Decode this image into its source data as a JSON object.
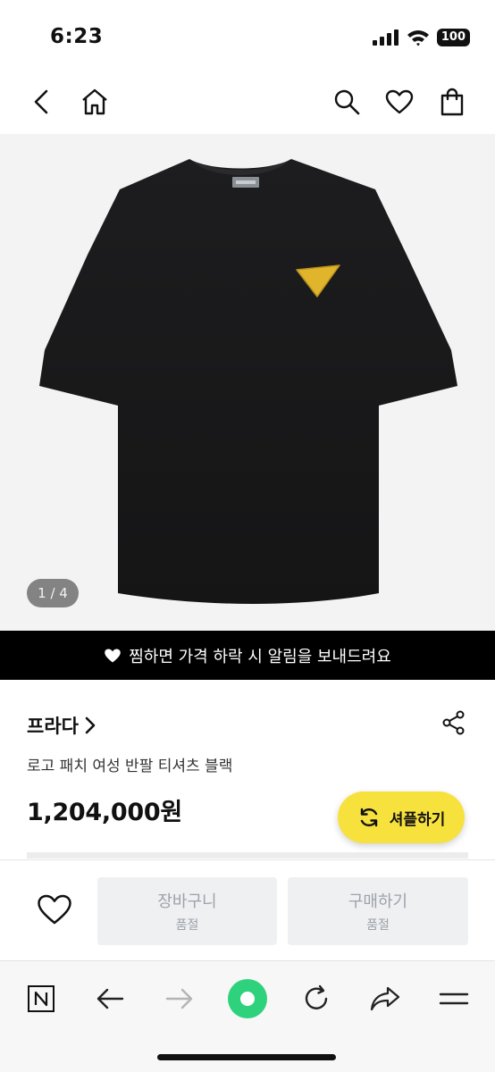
{
  "status_bar": {
    "time": "6:23",
    "battery": "100"
  },
  "nav": {
    "icons": [
      "back-icon",
      "home-icon",
      "search-icon",
      "heart-icon",
      "shopping-bag-icon"
    ]
  },
  "image": {
    "counter": "1 / 4"
  },
  "banner": {
    "text": "찜하면 가격 하락 시 알림을 보내드려요"
  },
  "product": {
    "brand": "프라다",
    "name": "로고 패치 여성 반팔 티셔츠 블랙",
    "price": "1,204,000원"
  },
  "shuffle": {
    "label": "셔플하기"
  },
  "actions": {
    "cart": {
      "label": "장바구니",
      "status": "품절"
    },
    "buy": {
      "label": "구매하기",
      "status": "품절"
    }
  },
  "colors": {
    "accent_yellow": "#f7e13c",
    "disabled_bg": "#eef0f2",
    "disabled_text": "#9da2a8",
    "naver_green": "#2fd27c"
  }
}
